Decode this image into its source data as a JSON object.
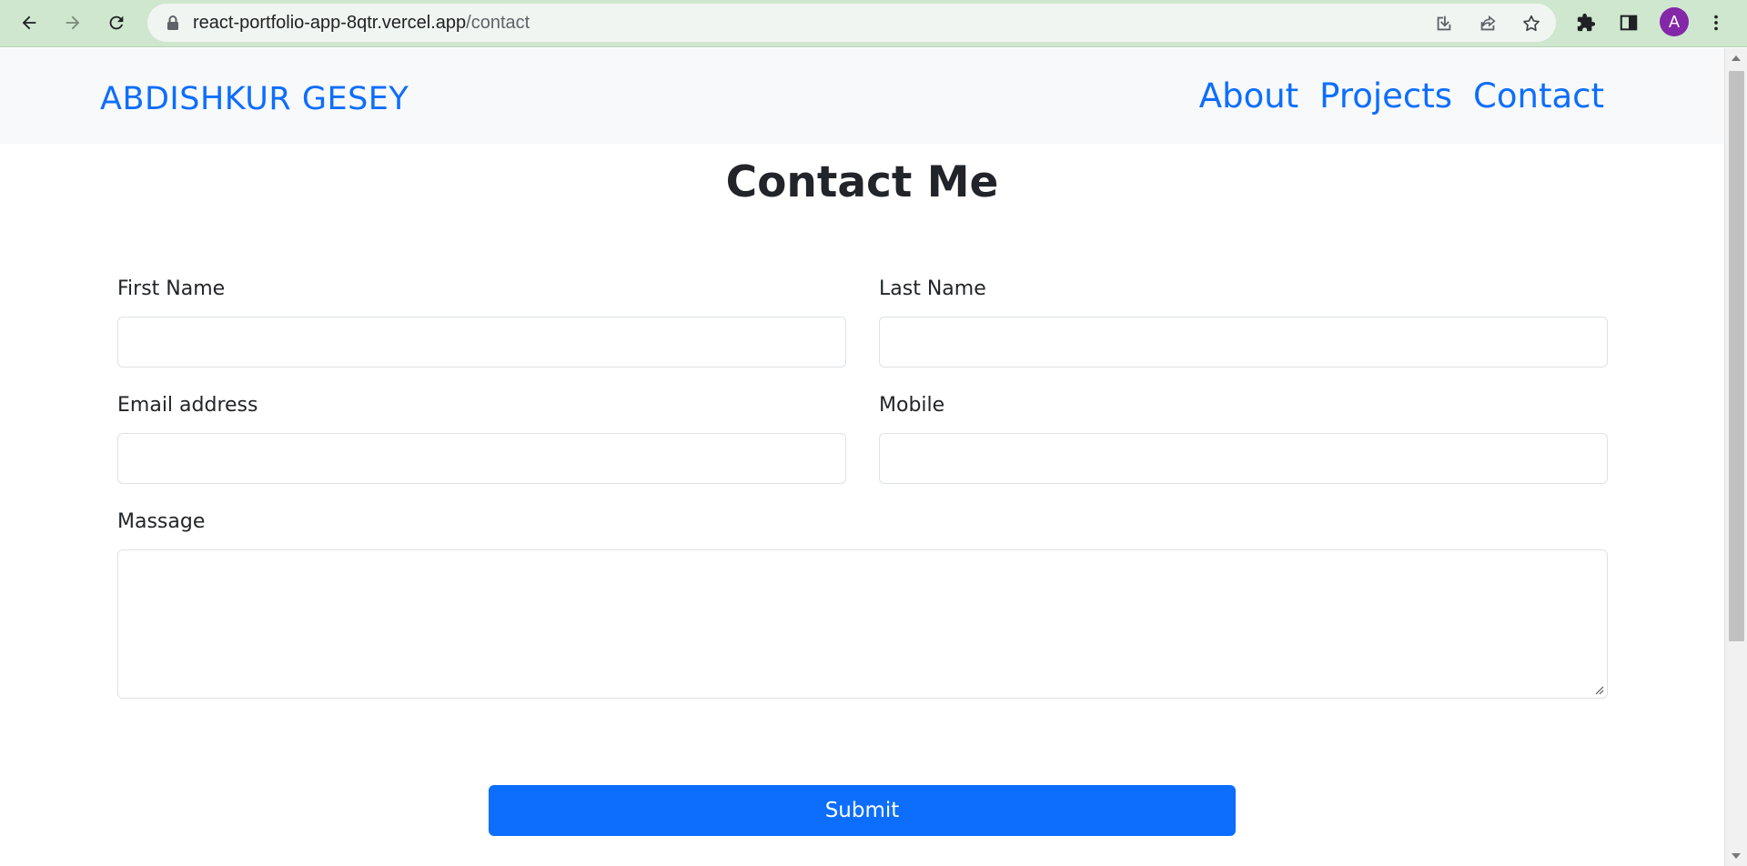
{
  "browser": {
    "url_host": "react-portfolio-app-8qtr.vercel.app",
    "url_path": "/contact",
    "avatar_letter": "A",
    "icons": [
      "back-icon",
      "forward-icon",
      "reload-icon",
      "lock-icon",
      "install-icon",
      "share-icon",
      "bookmark-star-icon",
      "extensions-icon",
      "side-panel-icon",
      "menu-kebab-icon"
    ]
  },
  "navbar": {
    "brand": "ABDISHKUR GESEY",
    "links": [
      "About",
      "Projects",
      "Contact"
    ]
  },
  "page": {
    "title": "Contact Me"
  },
  "form": {
    "first_name_label": "First Name",
    "first_name_value": "",
    "last_name_label": "Last Name",
    "last_name_value": "",
    "email_label": "Email address",
    "email_value": "",
    "mobile_label": "Mobile",
    "mobile_value": "",
    "message_label": "Massage",
    "message_value": "",
    "submit_label": "Submit"
  },
  "colors": {
    "accent": "#0d6efd",
    "navbar_bg": "#f8f9fa",
    "chrome_bg": "#cfe7cf",
    "text": "#212529"
  }
}
